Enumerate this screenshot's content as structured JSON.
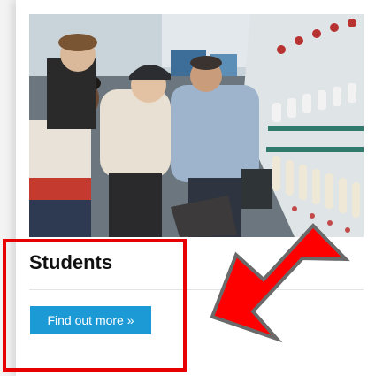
{
  "card": {
    "title": "Students",
    "button_label": "Find out more »",
    "image_alt": "Students and an instructor looking at a textile spinning machine"
  },
  "annotations": {
    "highlight_color": "#e60000",
    "arrow_color": "#ff0000"
  },
  "colors": {
    "button": "#1c9ad6",
    "background": "#f3f3f3"
  }
}
